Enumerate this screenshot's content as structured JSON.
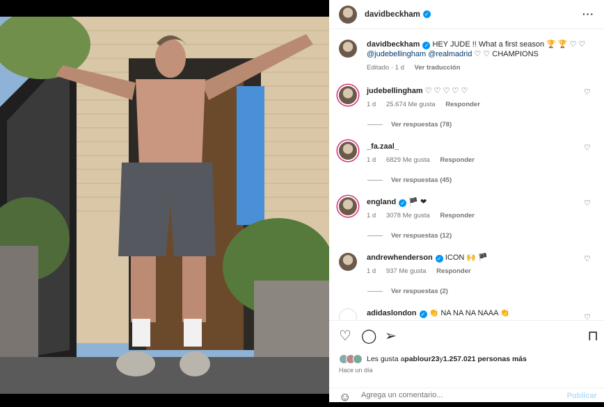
{
  "post": {
    "author": "davidbeckham",
    "caption_user": "davidbeckham",
    "caption_text": "HEY JUDE !! What a first season 🏆 🏆 ♡ ♡",
    "caption_mentions": "@judebellingham @realmadrid",
    "caption_tail": "♡ ♡ CHAMPIONS",
    "edited": "Editado · 1 d",
    "see_translation": "Ver traducción"
  },
  "comments": [
    {
      "user": "judebellingham",
      "text": "♡ ♡ ♡ ♡ ♡",
      "time": "1 d",
      "likes": "25.674 Me gusta",
      "reply": "Responder",
      "replies": "Ver respuestas (78)"
    },
    {
      "user": "_fa.zaal_",
      "text": "",
      "time": "1 d",
      "likes": "6829 Me gusta",
      "reply": "Responder",
      "replies": "Ver respuestas (45)"
    },
    {
      "user": "england",
      "text": "🏴 ❤",
      "time": "1 d",
      "likes": "3078 Me gusta",
      "reply": "Responder",
      "replies": "Ver respuestas (12)"
    },
    {
      "user": "andrewhenderson",
      "text": "ICON 🙌 🏴",
      "time": "1 d",
      "likes": "937 Me gusta",
      "reply": "Responder",
      "replies": "Ver respuestas (2)"
    },
    {
      "user": "adidaslondon",
      "text": "👏 NA NA NA NAAA 👏",
      "time": "",
      "likes": "",
      "reply": "",
      "replies": ""
    }
  ],
  "likes_summary": {
    "prefix": "Les gusta a ",
    "user": "pablour23",
    "middle": " y ",
    "count": "1.257.021 personas más"
  },
  "timestamp": "Hace un día",
  "add_comment": {
    "placeholder": "Agrega un comentario...",
    "post_label": "Publicar"
  },
  "icons": {
    "verified": "verified-badge-icon",
    "like": "heart-icon",
    "comment": "comment-icon",
    "share": "share-icon",
    "save": "bookmark-icon",
    "more": "more-icon",
    "emoji": "emoji-icon"
  },
  "colors": {
    "verified_blue": "#0095f6",
    "link": "#00376b",
    "muted": "#737373",
    "post_button_disabled": "#b2dffc"
  }
}
